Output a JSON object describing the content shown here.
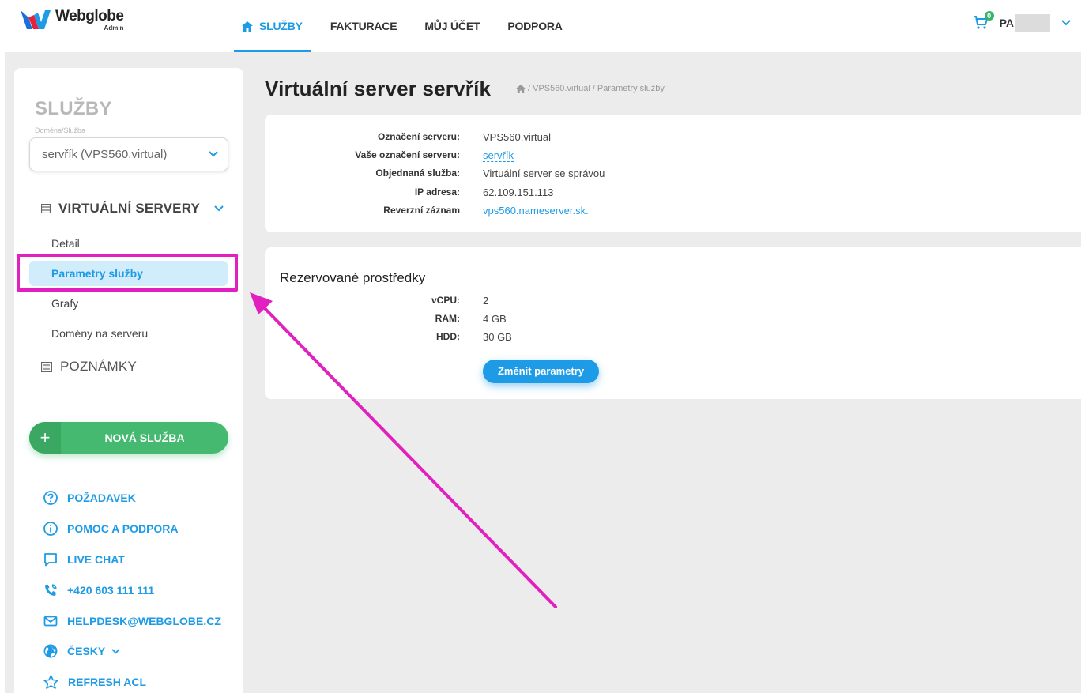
{
  "header": {
    "logo_name": "Webglobe",
    "logo_sub": "Admin",
    "nav": [
      "SLUŽBY",
      "FAKTURACE",
      "MŮJ ÚČET",
      "PODPORA"
    ],
    "cart_count": "0",
    "user": "PA"
  },
  "sidebar": {
    "title": "SLUŽBY",
    "subtitle": "Doména/Služba",
    "selected_service": "servřík (VPS560.virtual)",
    "group": "VIRTUÁLNÍ SERVERY",
    "items": [
      "Detail",
      "Parametry služby",
      "Grafy",
      "Domény na serveru"
    ],
    "notes": "POZNÁMKY",
    "new_service": "NOVÁ SLUŽBA",
    "links": [
      "POŽADAVEK",
      "POMOC A PODPORA",
      "LIVE CHAT",
      "+420 603 111 111",
      "HELPDESK@WEBGLOBE.CZ",
      "ČESKY",
      "REFRESH ACL"
    ]
  },
  "main": {
    "title": "Virtuální server servřík",
    "breadcrumb": {
      "separator": "/",
      "link": "VPS560.virtual",
      "current": "Parametry služby"
    },
    "server_info": [
      {
        "label": "Označení serveru:",
        "value": "VPS560.virtual"
      },
      {
        "label": "Vaše označení serveru:",
        "value": "servřík"
      },
      {
        "label": "Objednaná služba:",
        "value": "Virtuální server se správou"
      },
      {
        "label": "IP adresa:",
        "value": "62.109.151.113"
      },
      {
        "label": "Reverzní záznam",
        "value": "vps560.nameserver.sk."
      }
    ],
    "resources_title": "Rezervované prostředky",
    "resources": [
      {
        "label": "vCPU:",
        "value": "2"
      },
      {
        "label": "RAM:",
        "value": "4 GB"
      },
      {
        "label": "HDD:",
        "value": "30 GB"
      }
    ],
    "change_button": "Změnit parametry"
  },
  "colors": {
    "accent": "#1e9be6",
    "green": "#46b971",
    "highlight": "#e21fbf"
  }
}
